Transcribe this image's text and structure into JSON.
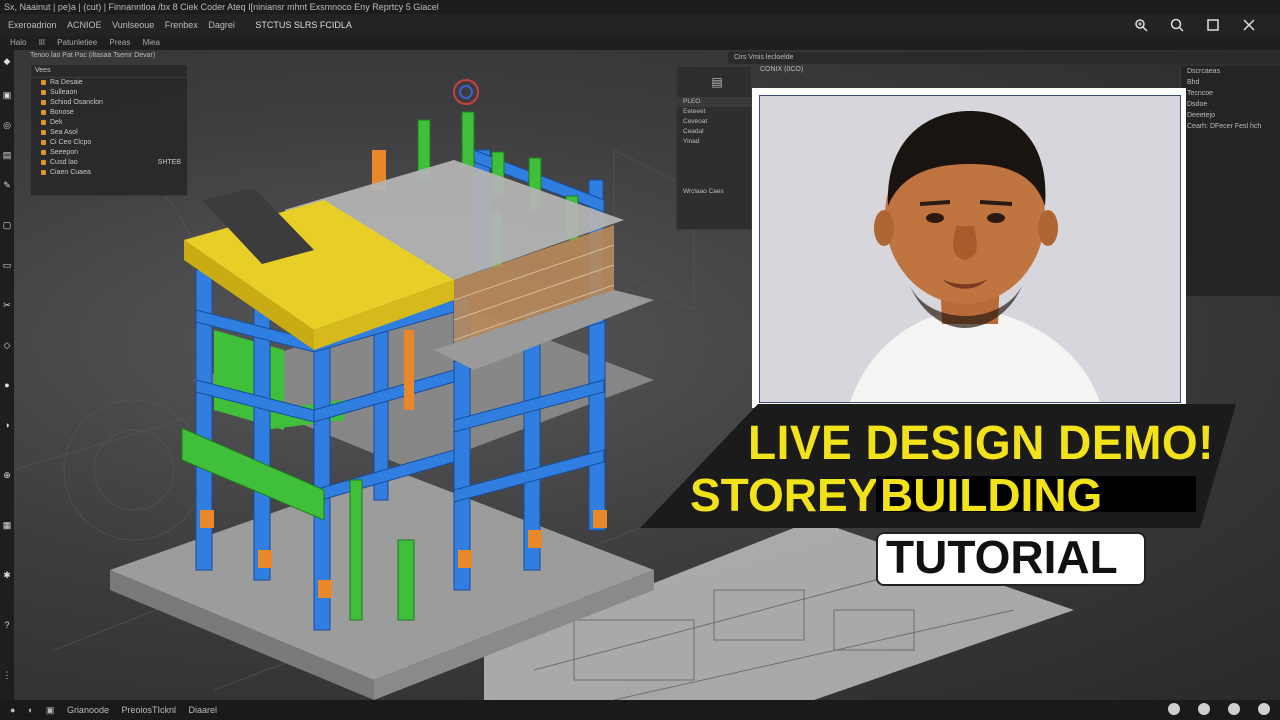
{
  "titlebar": {
    "text": "Sx, Naainut | pe)a | (cut) | Finnanntloa /bx 8 Ciek Coder Ateq I[niniansr mhnt Exsmnoco Eny Reprtcy 5 Giacel"
  },
  "menubar": {
    "items": [
      "Exeroadrion",
      "ACNIOE",
      "Vunlseoue",
      "Frenbex",
      "Dagrei"
    ],
    "title": "STCTUS SLRS FCIDLA"
  },
  "ribbon": {
    "items": [
      "Halo",
      "IlI",
      "Patunletiee",
      "Preas",
      "Miea"
    ]
  },
  "tree_panel": {
    "subtitle": "Tenoo lao Pat Pac (iltasaa Tsemr Devar)",
    "header": "Vees",
    "rows": [
      {
        "label": "Ra Desaie",
        "value": ""
      },
      {
        "label": "Sulleaon",
        "value": ""
      },
      {
        "label": "Schiod Osanclon",
        "value": ""
      },
      {
        "label": "Bonose",
        "value": ""
      },
      {
        "label": "Dek",
        "value": ""
      },
      {
        "label": "Sea Asol",
        "value": ""
      },
      {
        "label": "Ci Ceo Clcpo",
        "value": ""
      },
      {
        "label": "Seeepon",
        "value": ""
      },
      {
        "label": "Cusd lao",
        "value": "SHTEB"
      },
      {
        "label": "Ciaen Cuaea",
        "value": ""
      }
    ]
  },
  "properties_panel": {
    "header": "Cirs Vmis lecloelde",
    "subheader": "CONIX (0CO)",
    "tab": "PLEO",
    "rows": [
      "Eeteeet",
      "Ceveoat",
      "Ceadal",
      "Yinad"
    ],
    "footer": "Wrclaao Caes"
  },
  "right_panel": {
    "rows": [
      "Dscrcaeas",
      "Bhd",
      "Tecncoe",
      "Dsdoe",
      "Deeetejo",
      "Cearh: DFecer Fesl hch"
    ]
  },
  "thumbnail": {
    "line1": "LIVE DESIGN DEMO!",
    "line2a": "STOREY",
    "line2b": "BUILDING",
    "line3": "TUTORIAL"
  },
  "taskbar": {
    "items": [
      "Grianoode",
      "PreoiosTIcknl",
      "Diaarel"
    ]
  },
  "colors": {
    "accent_yellow": "#f2e21a",
    "beam_blue": "#2f7ee0",
    "green": "#3fbf3a",
    "orange": "#e8882a"
  }
}
